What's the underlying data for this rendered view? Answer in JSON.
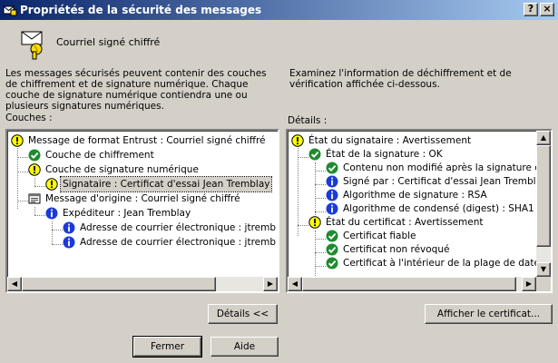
{
  "window": {
    "title": "Propriétés de la sécurité des messages",
    "help_label": "?",
    "close_label": "×"
  },
  "header": {
    "label": "Courriel signé chiffré"
  },
  "left_description": "Les messages sécurisés peuvent contenir des couches de chiffrement et de signature numérique. Chaque couche de signature numérique contiendra une ou plusieurs signatures numériques.",
  "right_description": "Examinez l'information de déchiffrement et de vérification affichée ci-dessous.",
  "left_group_label": "Couches :",
  "right_group_label": "Détails :",
  "left_tree": [
    {
      "icon": "warning",
      "label": "Message de format Entrust : Courriel signé chiffré"
    },
    {
      "icon": "check",
      "label": "Couche de chiffrement"
    },
    {
      "icon": "warning",
      "label": "Couche de signature numérique"
    },
    {
      "icon": "warning",
      "label": "Signataire : Certificat d'essai Jean Tremblay",
      "selected": true
    },
    {
      "icon": "document",
      "label": "Message d'origine : Courriel signé chiffré"
    },
    {
      "icon": "info",
      "label": "Expéditeur : Jean Tremblay"
    },
    {
      "icon": "info",
      "label": "Adresse de courrier électronique : jtremb"
    },
    {
      "icon": "info",
      "label": "Adresse de courrier électronique : jtremb"
    }
  ],
  "right_tree": [
    {
      "icon": "warning",
      "label": "État du signataire : Avertissement"
    },
    {
      "icon": "check",
      "label": "État de la signature : OK"
    },
    {
      "icon": "check",
      "label": "Contenu non modifié après la signature du"
    },
    {
      "icon": "info",
      "label": "Signé par : Certificat d'essai Jean Tremblay"
    },
    {
      "icon": "info",
      "label": "Algorithme de signature : RSA"
    },
    {
      "icon": "info",
      "label": "Algorithme de condensé (digest) : SHA1"
    },
    {
      "icon": "warning",
      "label": "État du certificat : Avertissement"
    },
    {
      "icon": "check",
      "label": "Certificat fiable"
    },
    {
      "icon": "check",
      "label": "Certificat non révoqué"
    },
    {
      "icon": "check",
      "label": "Certificat à l'intérieur de la plage de dates v"
    }
  ],
  "buttons": {
    "details": "Détails <<",
    "afficher": "Afficher le certificat...",
    "fermer": "Fermer",
    "aide": "Aide"
  },
  "colors": {
    "title_start": "#0a246a",
    "title_end": "#a6caf0",
    "warning": "#ffff00",
    "check": "#1e8c2e",
    "info": "#1c3ad8",
    "selection": "#d4d0c8"
  }
}
